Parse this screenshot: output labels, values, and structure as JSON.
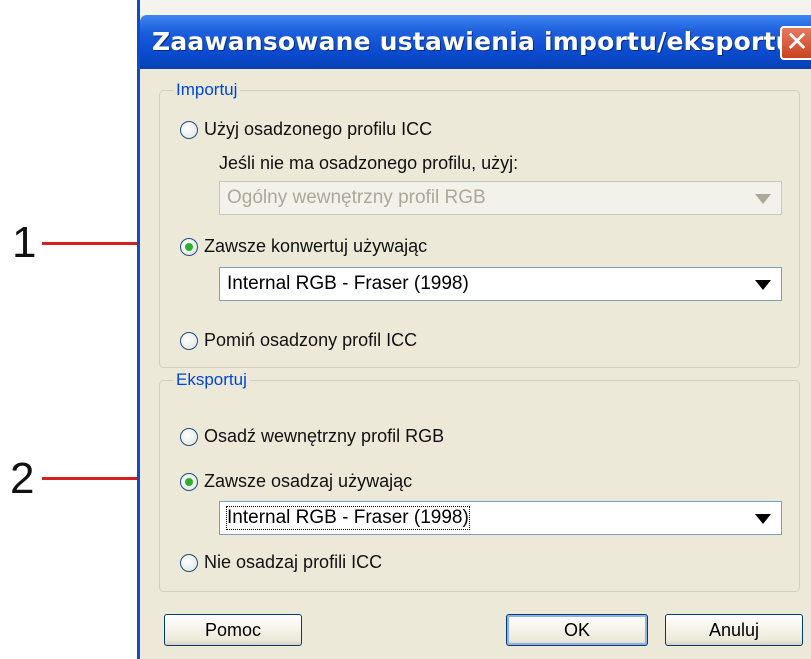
{
  "callouts": [
    {
      "number": "1"
    },
    {
      "number": "2"
    }
  ],
  "dialog": {
    "title": "Zaawansowane ustawienia importu/eksportu",
    "close_symbol": "✕"
  },
  "import": {
    "legend": "Importuj",
    "use_embedded_label": "Użyj osadzonego profilu ICC",
    "fallback_label": "Jeśli nie ma osadzonego profilu, użyj:",
    "fallback_value": "Ogólny wewnętrzny profil RGB",
    "always_convert_label": "Zawsze konwertuj używając",
    "always_convert_value": "Internal RGB - Fraser (1998)",
    "ignore_embedded_label": "Pomiń osadzony profil ICC",
    "selected": "always_convert"
  },
  "export": {
    "legend": "Eksportuj",
    "embed_internal_label": "Osadź wewnętrzny profil RGB",
    "always_embed_label": "Zawsze osadzaj używając",
    "always_embed_value": "Internal RGB - Fraser (1998)",
    "no_embed_label": "Nie osadzaj profili ICC",
    "selected": "always_embed"
  },
  "buttons": {
    "help": "Pomoc",
    "ok": "OK",
    "cancel": "Anuluj"
  },
  "colors": {
    "titlebar": "#0a4bd0",
    "legend": "#0046d5",
    "callout_arrow": "#d42020",
    "radio_dot": "#2bb02b"
  }
}
